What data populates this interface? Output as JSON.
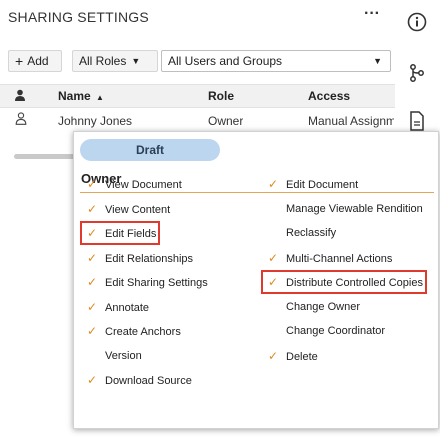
{
  "header": {
    "title": "SHARING SETTINGS",
    "more": "···"
  },
  "toolbar": {
    "add_label": "Add",
    "roles_label": "All Roles",
    "users_select": "All Users and Groups"
  },
  "table": {
    "columns": [
      "Name",
      "Role",
      "Access"
    ],
    "sort_indicator": "▲",
    "row": {
      "name": "Johnny Jones",
      "role": "Owner",
      "access": "Manual Assignm"
    }
  },
  "popup": {
    "badge": "Draft",
    "title": "Owner",
    "left_permissions": [
      {
        "label": "View Document",
        "checked": true
      },
      {
        "label": "View Content",
        "checked": true
      },
      {
        "label": "Edit Fields",
        "checked": true
      },
      {
        "label": "Edit Relationships",
        "checked": true
      },
      {
        "label": "Edit Sharing Settings",
        "checked": true
      },
      {
        "label": "Annotate",
        "checked": true
      },
      {
        "label": "Create Anchors",
        "checked": true
      },
      {
        "label": "Version",
        "checked": false
      },
      {
        "label": "Download Source",
        "checked": true
      }
    ],
    "right_permissions": [
      {
        "label": "Edit Document",
        "checked": true
      },
      {
        "label": "Manage Viewable Rendition",
        "checked": false
      },
      {
        "label": "Reclassify",
        "checked": false
      },
      {
        "label": "Multi-Channel Actions",
        "checked": true
      },
      {
        "label": "Distribute Controlled Copies",
        "checked": true
      },
      {
        "label": "Change Owner",
        "checked": false
      },
      {
        "label": "Change Coordinator",
        "checked": false
      },
      {
        "label": "Delete",
        "checked": true
      }
    ],
    "highlighted": [
      "Edit Fields",
      "Distribute Controlled Copies"
    ]
  },
  "colors": {
    "check": "#e08a1f",
    "highlight": "#e03a2e",
    "badge": "#bcd6ef",
    "divider": "#e6a35a"
  },
  "icons": [
    "info-icon",
    "workflow-icon",
    "document-icon",
    "user-icon"
  ]
}
